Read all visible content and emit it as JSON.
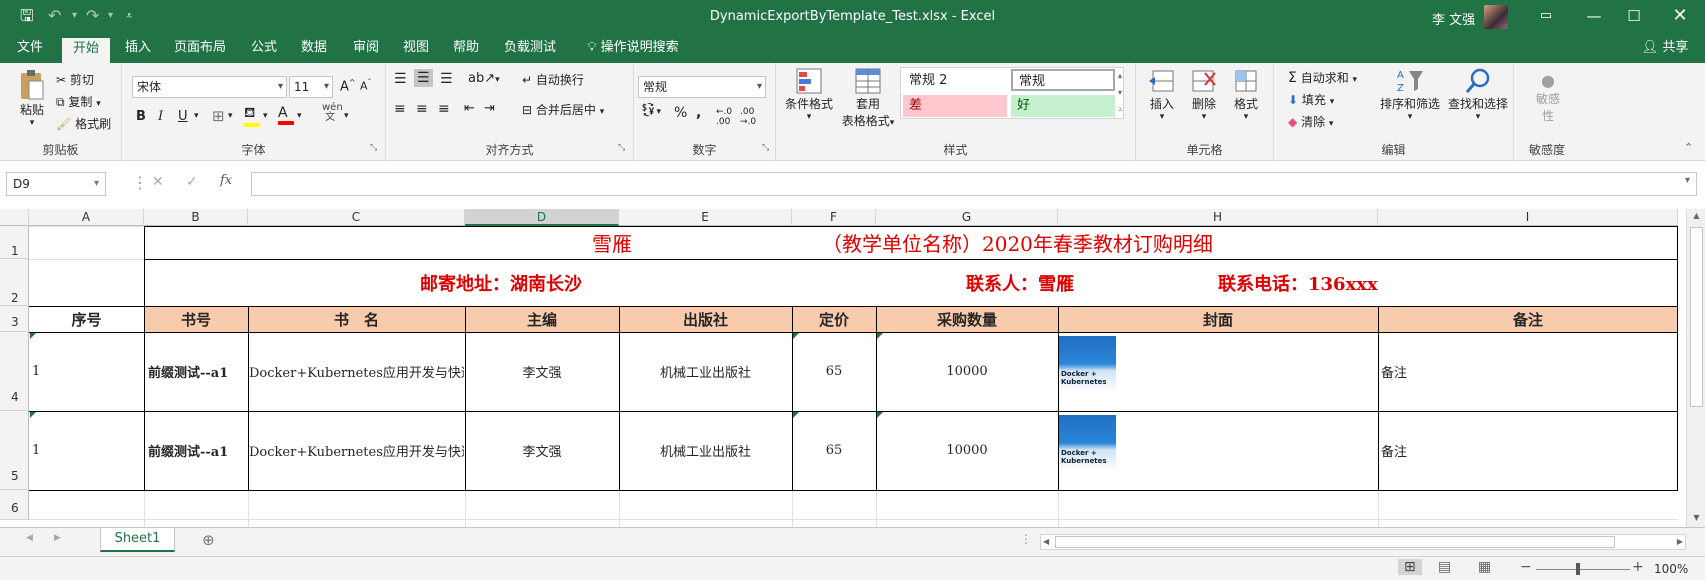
{
  "title_bar": {
    "file": "DynamicExportByTemplate_Test.xlsx  -  Excel",
    "user": "李 文强"
  },
  "menu": {
    "tabs": [
      "文件",
      "开始",
      "插入",
      "页面布局",
      "公式",
      "数据",
      "审阅",
      "视图",
      "帮助",
      "负载测试"
    ],
    "active": "开始",
    "tell_me": "操作说明搜索",
    "share": "共享"
  },
  "ribbon": {
    "clipboard": {
      "paste": "粘贴",
      "cut": "剪切",
      "copy": "复制",
      "format_painter": "格式刷",
      "label": "剪贴板"
    },
    "font": {
      "name": "宋体",
      "size": "11",
      "bold": "B",
      "italic": "I",
      "underline": "U",
      "label": "字体"
    },
    "alignment": {
      "wrap": "自动换行",
      "merge": "合并后居中",
      "label": "对齐方式"
    },
    "number": {
      "format": "常规",
      "label": "数字"
    },
    "styles": {
      "conditional": "条件格式",
      "table_line1": "套用",
      "table_line2": "表格格式",
      "normal2": "常规 2",
      "normal": "常规",
      "bad": "差",
      "good": "好",
      "label": "样式"
    },
    "cells": {
      "insert": "插入",
      "delete": "删除",
      "format": "格式",
      "label": "单元格"
    },
    "editing": {
      "autosum": "自动求和",
      "fill": "填充",
      "clear": "清除",
      "sort": "排序和筛选",
      "find": "查找和选择",
      "label": "编辑"
    },
    "sensitivity": {
      "btn_line1": "敏感",
      "btn_line2": "性",
      "label": "敏感度"
    }
  },
  "formula_bar": {
    "cell_ref": "D9",
    "fx": "fx",
    "content": ""
  },
  "columns": [
    "A",
    "B",
    "C",
    "D",
    "E",
    "F",
    "G",
    "H",
    "I"
  ],
  "rows": [
    "1",
    "2",
    "3",
    "4",
    "5",
    "6"
  ],
  "sheet": {
    "title_left": "雪雁",
    "title_right": "（教学单位名称）2020年春季教材订购明细",
    "address": "邮寄地址：湖南长沙",
    "contact": "联系人：雪雁",
    "phone": "联系电话：136xxx",
    "headers": [
      "序号",
      "书号",
      "书　名",
      "主编",
      "出版社",
      "定价",
      "采购数量",
      "封面",
      "备注"
    ],
    "data": [
      {
        "seq": "1",
        "isbn": "前缀测试--a1",
        "name": "Docker+Kubernetes应用开发与快速上手",
        "editor": "李文强",
        "publisher": "机械工业出版社",
        "price": "65",
        "qty": "10000",
        "note": "备注"
      },
      {
        "seq": "1",
        "isbn": "前缀测试--a1",
        "name": "Docker+Kubernetes应用开发与快速上手",
        "editor": "李文强",
        "publisher": "机械工业出版社",
        "price": "65",
        "qty": "10000",
        "note": "备注"
      }
    ],
    "cover_text": "Docker + Kubernetes"
  },
  "sheet_tabs": {
    "active": "Sheet1"
  },
  "status": {
    "zoom": "100%"
  }
}
